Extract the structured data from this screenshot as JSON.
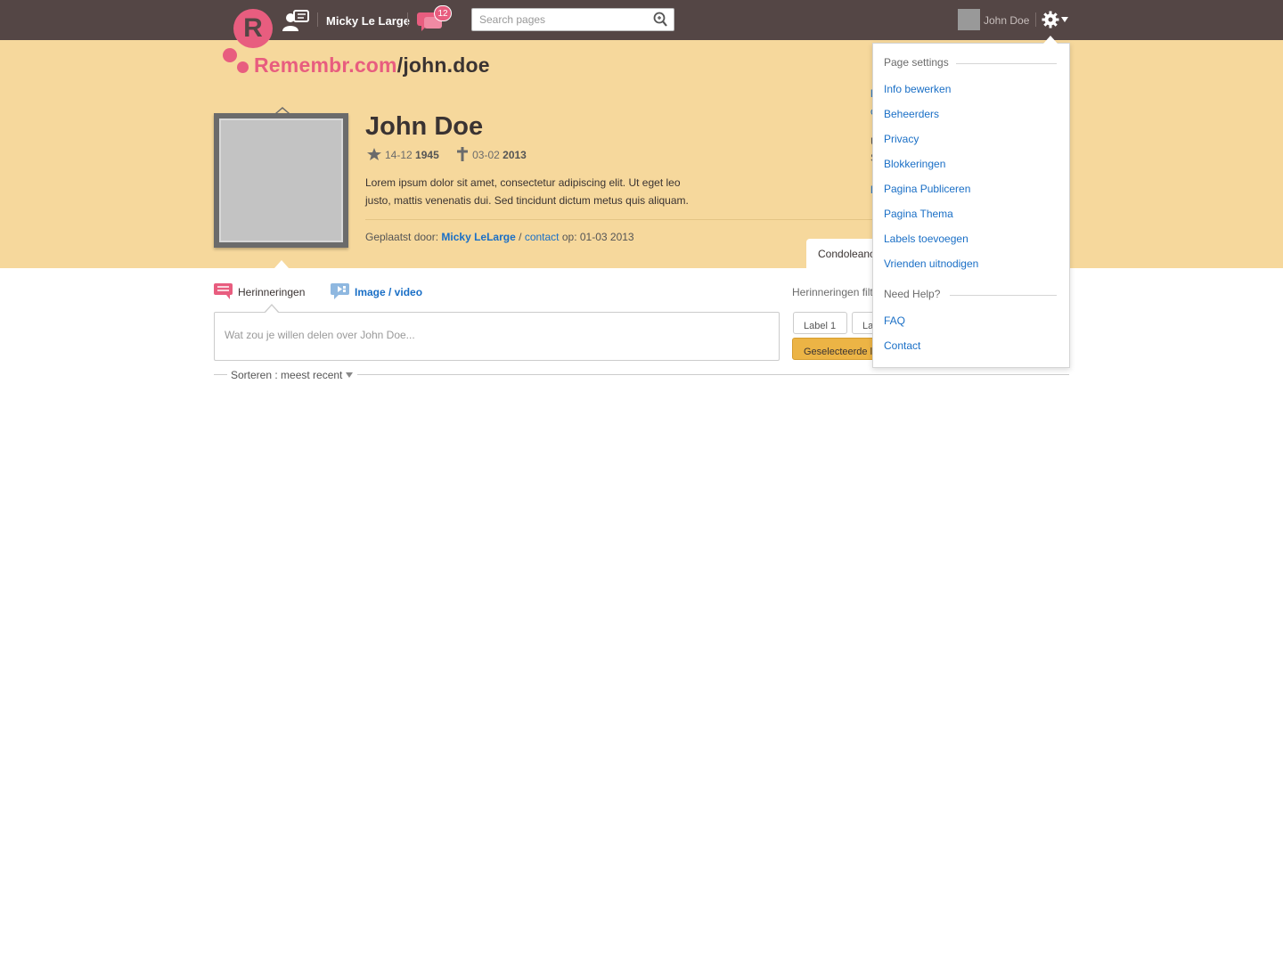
{
  "topbar": {
    "user_name": "Micky Le Large",
    "notification_count": "12",
    "search_placeholder": "Search pages",
    "account_name": "John Doe"
  },
  "logo": {
    "letter": "R"
  },
  "site": {
    "domain": "Remembr.com",
    "slash": "/",
    "slug": "john.doe"
  },
  "profile": {
    "name": "John Doe",
    "birth_day": "14-12",
    "birth_year": "1945",
    "death_day": "03-02",
    "death_year": "2013",
    "bio": "Lorem ipsum dolor sit amet, consectetur adipiscing elit. Ut eget leo justo, mattis venenatis dui. Sed tincidunt dictum metus quis aliquam.",
    "posted_prefix": "Geplaatst door:",
    "posted_by": "Micky LeLarge",
    "posted_sep": "/",
    "contact_link": "contact",
    "posted_suffix": "op: 01-03 2013"
  },
  "tabs": {
    "condolence": "Condoleanc",
    "memories": "Herinneringen",
    "image_video": "Image / video"
  },
  "composer": {
    "placeholder": "Wat zou je willen delen over John Doe..."
  },
  "filter": {
    "title": "Herinneringen filt",
    "label1": "Label 1",
    "label2": "La",
    "selected": "Geselecteerde l"
  },
  "sort": {
    "label": "Sorteren : meest recent"
  },
  "dropdown": {
    "section1": "Page settings",
    "items1": [
      "Info bewerken",
      "Beheerders",
      "Privacy",
      "Blokkeringen",
      "Pagina Publiceren",
      "Pagina Thema",
      "Labels toevoegen",
      "Vrienden uitnodigen"
    ],
    "section2": "Need Help?",
    "items2": [
      "FAQ",
      "Contact"
    ]
  },
  "colors": {
    "topbar": "#544645",
    "band": "#f6d89c",
    "accent": "#e85d7f",
    "link": "#1a6fc6",
    "button": "#ecb445"
  }
}
